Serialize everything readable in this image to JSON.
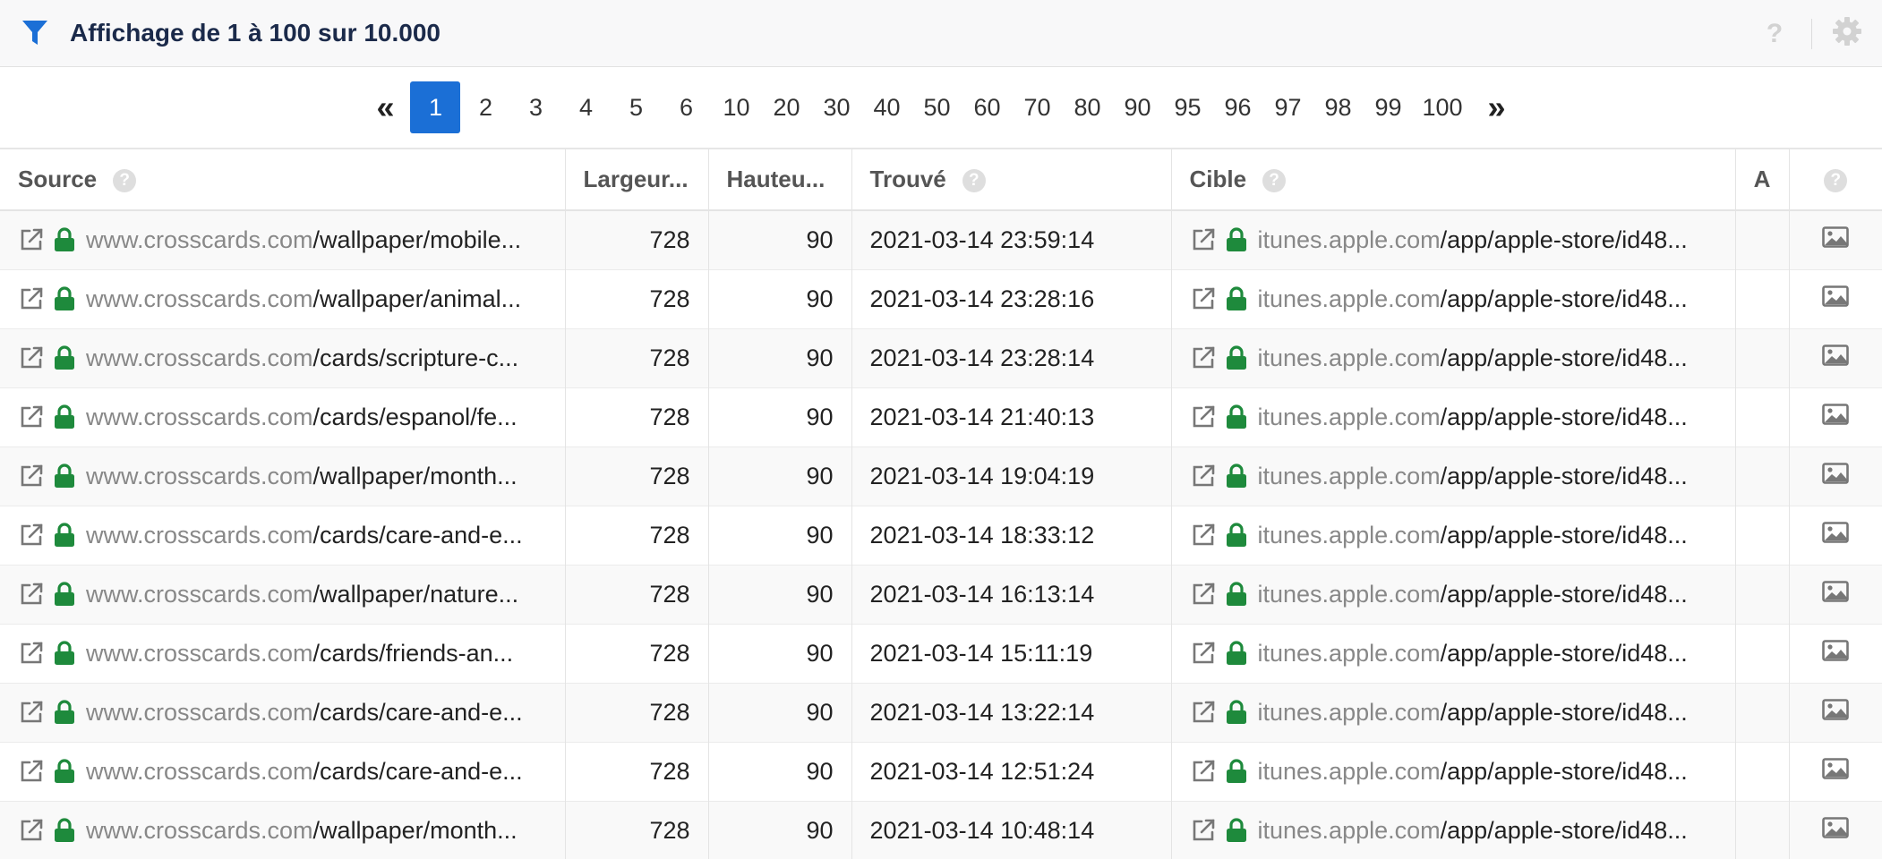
{
  "header": {
    "title": "Affichage de 1 à 100 sur 10.000",
    "help_label": "?"
  },
  "pagination": {
    "prev_label": "«",
    "next_label": "»",
    "pages": [
      "1",
      "2",
      "3",
      "4",
      "5",
      "6",
      "10",
      "20",
      "30",
      "40",
      "50",
      "60",
      "70",
      "80",
      "90",
      "95",
      "96",
      "97",
      "98",
      "99",
      "100"
    ],
    "active": "1"
  },
  "table": {
    "columns": {
      "source": "Source",
      "largeur": "Largeur...",
      "hauteur": "Hauteu...",
      "trouve": "Trouvé",
      "cible": "Cible",
      "a": "A"
    },
    "help_label": "?",
    "rows": [
      {
        "src_domain": "www.crosscards.com",
        "src_path": "/wallpaper/mobile...",
        "width": "728",
        "height": "90",
        "found": "2021-03-14 23:59:14",
        "tgt_domain": "itunes.apple.com",
        "tgt_path": "/app/apple-store/id48..."
      },
      {
        "src_domain": "www.crosscards.com",
        "src_path": "/wallpaper/animal...",
        "width": "728",
        "height": "90",
        "found": "2021-03-14 23:28:16",
        "tgt_domain": "itunes.apple.com",
        "tgt_path": "/app/apple-store/id48..."
      },
      {
        "src_domain": "www.crosscards.com",
        "src_path": "/cards/scripture-c...",
        "width": "728",
        "height": "90",
        "found": "2021-03-14 23:28:14",
        "tgt_domain": "itunes.apple.com",
        "tgt_path": "/app/apple-store/id48..."
      },
      {
        "src_domain": "www.crosscards.com",
        "src_path": "/cards/espanol/fe...",
        "width": "728",
        "height": "90",
        "found": "2021-03-14 21:40:13",
        "tgt_domain": "itunes.apple.com",
        "tgt_path": "/app/apple-store/id48..."
      },
      {
        "src_domain": "www.crosscards.com",
        "src_path": "/wallpaper/month...",
        "width": "728",
        "height": "90",
        "found": "2021-03-14 19:04:19",
        "tgt_domain": "itunes.apple.com",
        "tgt_path": "/app/apple-store/id48..."
      },
      {
        "src_domain": "www.crosscards.com",
        "src_path": "/cards/care-and-e...",
        "width": "728",
        "height": "90",
        "found": "2021-03-14 18:33:12",
        "tgt_domain": "itunes.apple.com",
        "tgt_path": "/app/apple-store/id48..."
      },
      {
        "src_domain": "www.crosscards.com",
        "src_path": "/wallpaper/nature...",
        "width": "728",
        "height": "90",
        "found": "2021-03-14 16:13:14",
        "tgt_domain": "itunes.apple.com",
        "tgt_path": "/app/apple-store/id48..."
      },
      {
        "src_domain": "www.crosscards.com",
        "src_path": "/cards/friends-an...",
        "width": "728",
        "height": "90",
        "found": "2021-03-14 15:11:19",
        "tgt_domain": "itunes.apple.com",
        "tgt_path": "/app/apple-store/id48..."
      },
      {
        "src_domain": "www.crosscards.com",
        "src_path": "/cards/care-and-e...",
        "width": "728",
        "height": "90",
        "found": "2021-03-14 13:22:14",
        "tgt_domain": "itunes.apple.com",
        "tgt_path": "/app/apple-store/id48..."
      },
      {
        "src_domain": "www.crosscards.com",
        "src_path": "/cards/care-and-e...",
        "width": "728",
        "height": "90",
        "found": "2021-03-14 12:51:24",
        "tgt_domain": "itunes.apple.com",
        "tgt_path": "/app/apple-store/id48..."
      },
      {
        "src_domain": "www.crosscards.com",
        "src_path": "/wallpaper/month...",
        "width": "728",
        "height": "90",
        "found": "2021-03-14 10:48:14",
        "tgt_domain": "itunes.apple.com",
        "tgt_path": "/app/apple-store/id48..."
      }
    ]
  },
  "icons": {
    "filter": "filter-icon",
    "help": "help-icon",
    "settings": "gear-icon",
    "external": "external-link-icon",
    "lock": "lock-icon",
    "image": "image-icon"
  },
  "colors": {
    "accent": "#1b6fd6",
    "lock_green": "#1e8a3c",
    "title": "#1b2a4a"
  }
}
